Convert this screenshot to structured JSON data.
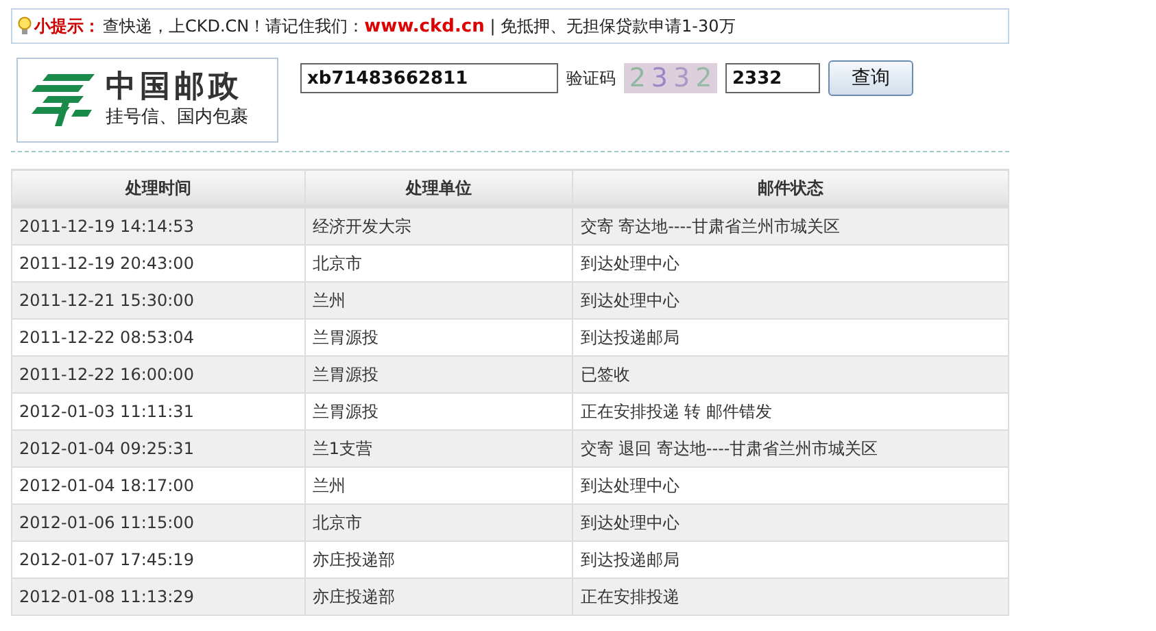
{
  "notice": {
    "label": "小提示：",
    "text_before": "查快递，上CKD.CN！请记住我们：",
    "link": "www.ckd.cn",
    "text_after": " | 免抵押、无担保贷款申请1-30万"
  },
  "logo": {
    "title": "中国邮政",
    "subtitle": "挂号信、国内包裹"
  },
  "query": {
    "tracking_number": "xb71483662811",
    "captcha_label": "验证码",
    "captcha_image": "2332",
    "captcha_value": "2332",
    "button": "查询"
  },
  "table": {
    "columns": [
      "处理时间",
      "处理单位",
      "邮件状态"
    ],
    "rows": [
      [
        "2011-12-19 14:14:53",
        "经济开发大宗",
        "交寄 寄达地----甘肃省兰州市城关区"
      ],
      [
        "2011-12-19 20:43:00",
        "北京市",
        "到达处理中心"
      ],
      [
        "2011-12-21 15:30:00",
        "兰州",
        "到达处理中心"
      ],
      [
        "2011-12-22 08:53:04",
        "兰胃源投",
        "到达投递邮局"
      ],
      [
        "2011-12-22 16:00:00",
        "兰胃源投",
        "已签收"
      ],
      [
        "2012-01-03 11:11:31",
        "兰胃源投",
        "正在安排投递 转 邮件错发"
      ],
      [
        "2012-01-04 09:25:31",
        "兰1支营",
        "交寄 退回 寄达地----甘肃省兰州市城关区"
      ],
      [
        "2012-01-04 18:17:00",
        "兰州",
        "到达处理中心"
      ],
      [
        "2012-01-06 11:15:00",
        "北京市",
        "到达处理中心"
      ],
      [
        "2012-01-07 17:45:19",
        "亦庄投递部",
        "到达投递邮局"
      ],
      [
        "2012-01-08 11:13:29",
        "亦庄投递部",
        "正在安排投递"
      ]
    ]
  }
}
